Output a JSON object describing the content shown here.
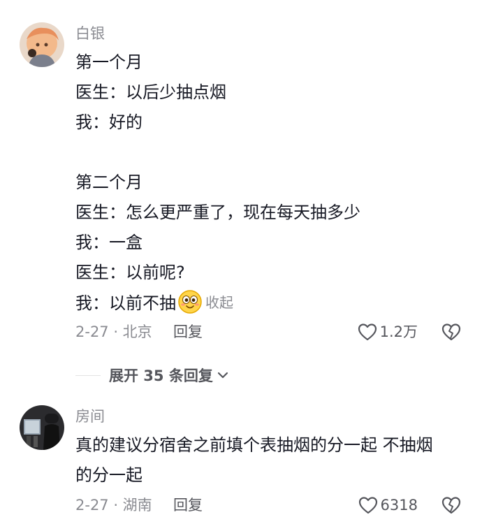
{
  "comments": [
    {
      "username": "白银",
      "lines": [
        "第一个月",
        "医生：以后少抽点烟",
        "我：好的",
        "",
        "第二个月",
        "医生：怎么更严重了，现在每天抽多少",
        "我：一盒",
        "医生：以前呢?",
        "我：以前不抽"
      ],
      "emoji": "grinning-face-emoji",
      "collapse_label": "收起",
      "date_location": "2-27 · 北京",
      "reply_label": "回复",
      "like_count": "1.2万"
    },
    {
      "username": "房间",
      "lines": [
        "真的建议分宿舍之前填个表抽烟的分一起 不抽烟",
        "的分一起"
      ],
      "date_location": "2-27 · 湖南",
      "reply_label": "回复",
      "like_count": "6318"
    }
  ],
  "expand_replies": {
    "label": "展开 35 条回复"
  },
  "colors": {
    "text": "#161823",
    "muted": "#8a8b91",
    "action": "#55565c"
  },
  "icons": [
    "heart-outline-icon",
    "broken-heart-icon",
    "chevron-down-icon"
  ]
}
